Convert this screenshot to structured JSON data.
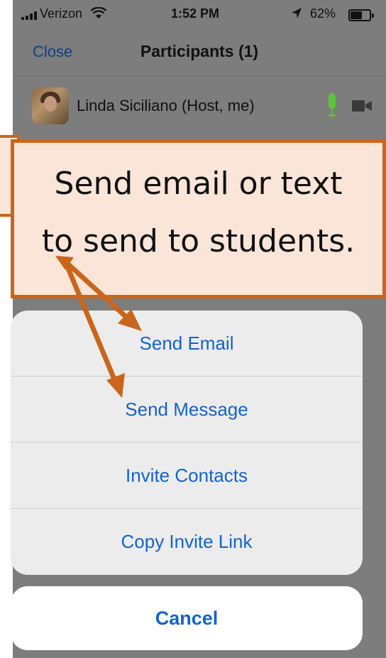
{
  "status_bar": {
    "carrier": "Verizon",
    "time": "1:52 PM",
    "battery_pct": "62%",
    "battery_level": 0.62
  },
  "navbar": {
    "close_label": "Close",
    "title": "Participants (1)"
  },
  "participant": {
    "name": "Linda Siciliano (Host, me)"
  },
  "action_sheet": {
    "items": [
      {
        "label": "Send Email"
      },
      {
        "label": "Send Message"
      },
      {
        "label": "Invite Contacts"
      },
      {
        "label": "Copy Invite Link"
      }
    ],
    "cancel_label": "Cancel"
  },
  "annotation": {
    "line1": "Send email or text",
    "line2": "to send to students."
  },
  "colors": {
    "accent_blue": "#1463c9",
    "callout_border": "#c9661b",
    "callout_fill": "#fbe5d8",
    "mic_green": "#5ec43b"
  },
  "icons": [
    "signal-icon",
    "wifi-icon",
    "location-icon",
    "battery-icon",
    "microphone-icon",
    "video-camera-icon"
  ]
}
